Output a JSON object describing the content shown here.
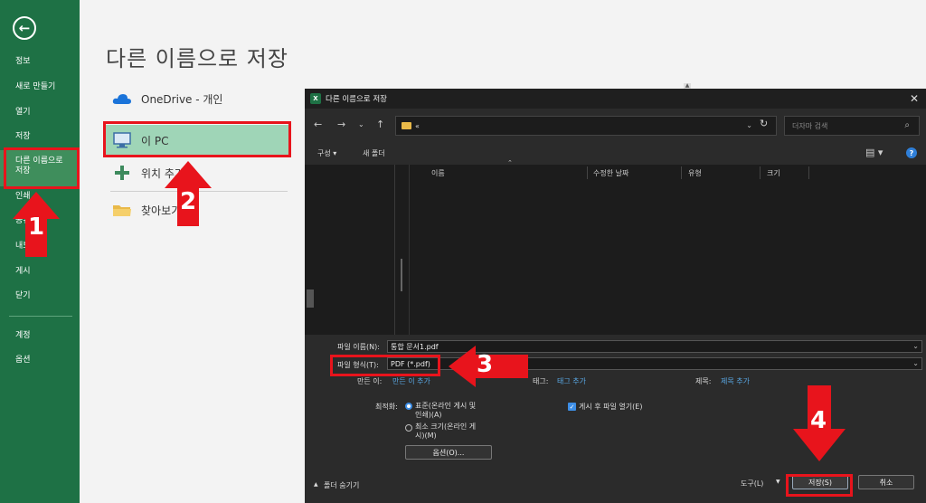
{
  "sidebar": {
    "items": [
      {
        "label": "정보"
      },
      {
        "label": "새로 만들기"
      },
      {
        "label": "열기"
      },
      {
        "label": "저장"
      },
      {
        "label": "다른 이름으로\n저장"
      },
      {
        "label": "인쇄"
      },
      {
        "label": "공유"
      },
      {
        "label": "내보내기"
      },
      {
        "label": "게시"
      },
      {
        "label": "닫기"
      },
      {
        "label": "계정"
      },
      {
        "label": "옵션"
      }
    ]
  },
  "backstage": {
    "title": "다른 이름으로 저장",
    "locations": [
      {
        "label": "OneDrive - 개인"
      },
      {
        "label": "이 PC"
      },
      {
        "label": "위치 추가"
      },
      {
        "label": "찾아보기"
      }
    ]
  },
  "dialog": {
    "title": "다른 이름으로 저장",
    "address": "«",
    "search_placeholder": "더자마 검색",
    "toolbar": {
      "organize": "구성 ▾",
      "new_folder": "새 폴더"
    },
    "columns": [
      "이름",
      "수정한 날짜",
      "유형",
      "크기"
    ],
    "filename_label": "파일 이름(N):",
    "filename_value": "통합 문서1.pdf",
    "filetype_label": "파일 형식(T):",
    "filetype_value": "PDF (*.pdf)",
    "author_label": "만든 이:",
    "author_value": "만든 이 추가",
    "tags_label": "태그:",
    "tags_value": "태그 추가",
    "title_label": "제목:",
    "title_value": "제목 추가",
    "optimize_label": "최적화:",
    "opt_standard": "표준(온라인 게시 및\n인쇄)(A)",
    "opt_minimum": "최소 크기(온라인 게\n시)(M)",
    "open_after": "게시 후 파일 열기(E)",
    "options_button": "옵션(O)...",
    "hide_folders": "폴더 숨기기",
    "tools_button": "도구(L)",
    "save_button": "저장(S)",
    "cancel_button": "취소"
  },
  "annotations": {
    "steps": [
      "1",
      "2",
      "3",
      "4"
    ],
    "color": "#e8141c"
  },
  "colors": {
    "excel_green": "#1e7145",
    "selected_location": "#9fd5b7"
  }
}
